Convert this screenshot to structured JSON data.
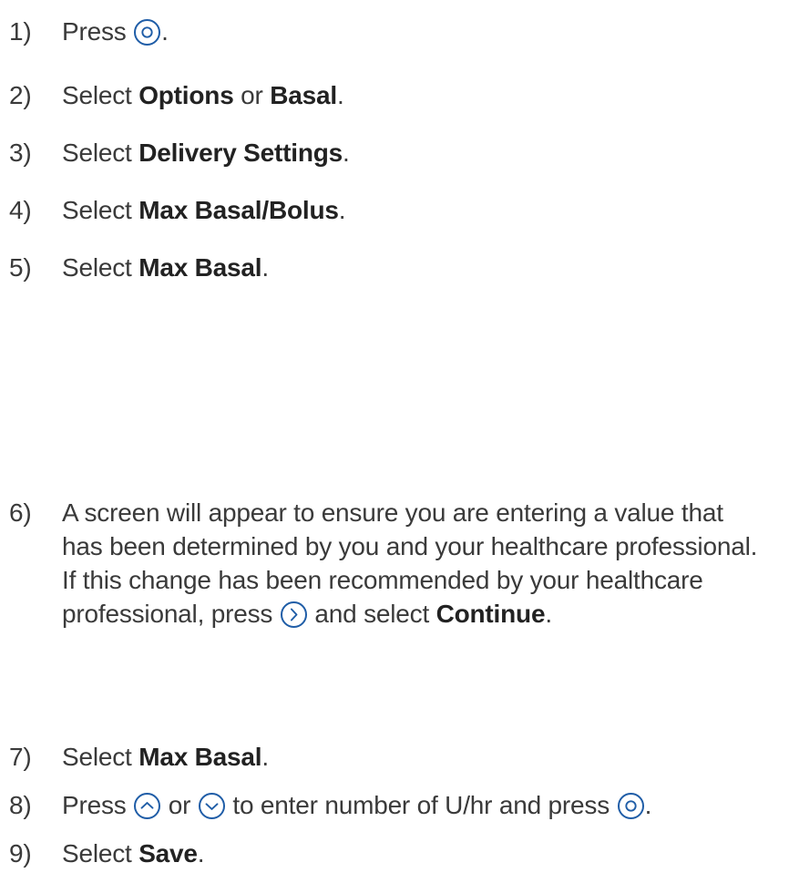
{
  "steps": [
    {
      "num": "1)",
      "parts": {
        "a": "Press ",
        "b": "."
      },
      "icon": "select-button-icon"
    },
    {
      "num": "2)",
      "parts": {
        "a": "Select ",
        "bold1": "Options",
        "mid": " or ",
        "bold2": "Basal",
        "end": "."
      }
    },
    {
      "num": "3)",
      "parts": {
        "a": "Select ",
        "bold1": "Delivery Settings",
        "end": "."
      }
    },
    {
      "num": "4)",
      "parts": {
        "a": "Select ",
        "bold1": "Max Basal/Bolus",
        "end": "."
      }
    },
    {
      "num": "5)",
      "parts": {
        "a": "Select ",
        "bold1": "Max Basal",
        "end": "."
      }
    },
    {
      "num": "6)",
      "lines": [
        "A screen will appear to ensure you are entering a value that",
        "has been determined by you and your healthcare professional.",
        "If this change has been recommended by your healthcare"
      ],
      "last": {
        "a": "professional,  press ",
        "b": " and select ",
        "bold1": "Continue",
        "end": "."
      },
      "icon": "right-button-icon"
    },
    {
      "num": "7)",
      "parts": {
        "a": "Select ",
        "bold1": "Max Basal",
        "end": "."
      }
    },
    {
      "num": "8)",
      "parts": {
        "a": "Press ",
        "b": " or ",
        "c": " to enter number of U/hr and press ",
        "d": "."
      },
      "icons": [
        "up-button-icon",
        "down-button-icon",
        "select-button-icon"
      ]
    },
    {
      "num": "9)",
      "parts": {
        "a": "Select ",
        "bold1": "Save",
        "end": "."
      }
    }
  ],
  "colors": {
    "text": "#3a3a3a",
    "icon_blue": "#1f5da7"
  }
}
